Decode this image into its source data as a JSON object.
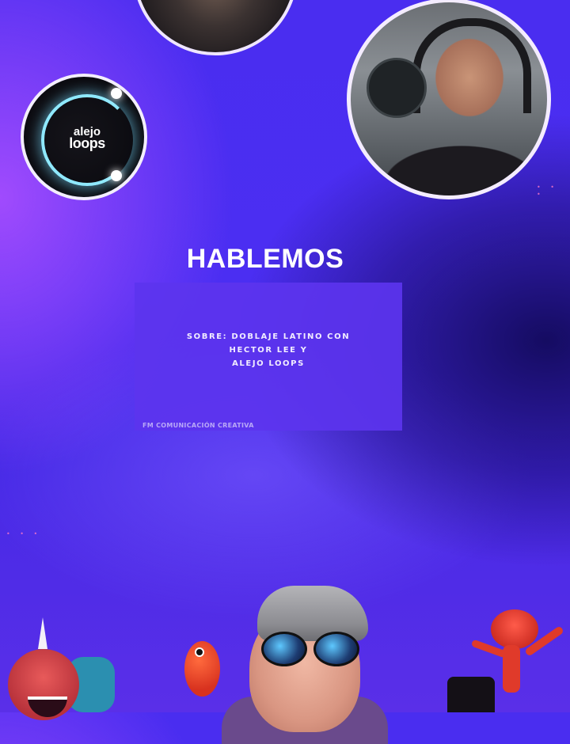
{
  "logo": {
    "line1": "alejo",
    "line2": "loops"
  },
  "headline": "HABLEMOS",
  "info": {
    "line1": "SOBRE: DOBLAJE LATINO CON",
    "line2": "HECTOR LEE Y",
    "line3": "ALEJO LOOPS",
    "credit": "FM COMUNICACIÓN CREATIVA"
  },
  "decor": {
    "dots_right": "• • •",
    "dots_left": "• • •"
  },
  "colors": {
    "background": "#4a2df0",
    "info_box": "#5c34ee",
    "circle_border": "#f4ecff",
    "logo_glow": "#8fe9ff"
  }
}
